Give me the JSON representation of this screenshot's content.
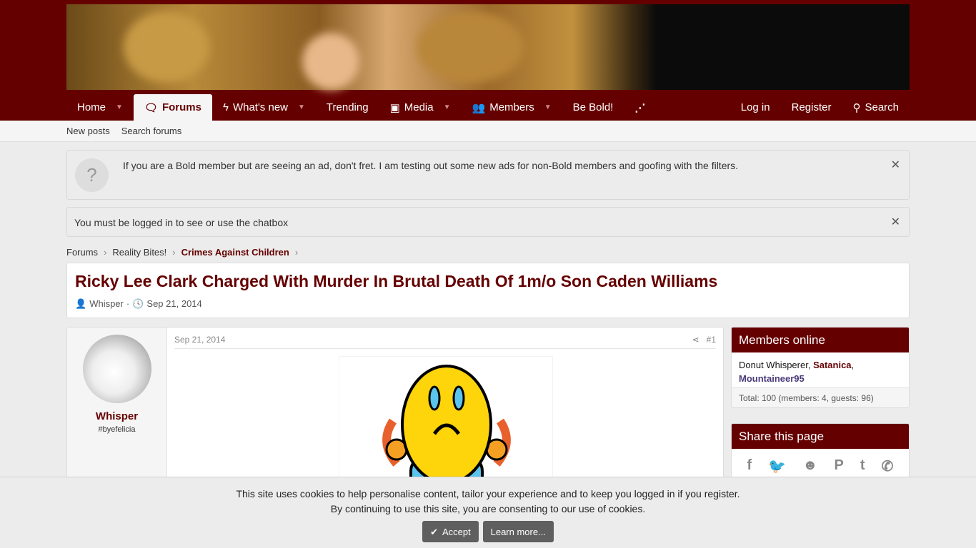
{
  "nav": {
    "items": [
      {
        "label": "Home",
        "caret": true
      },
      {
        "label": "Forums",
        "icon": "comments-icon",
        "selected": true
      },
      {
        "label": "What's new",
        "icon": "bolt-icon",
        "caret": true
      },
      {
        "label": "Trending"
      },
      {
        "label": "Media",
        "icon": "image-icon",
        "caret": true
      },
      {
        "label": "Members",
        "icon": "users-icon",
        "caret": true
      },
      {
        "label": "Be Bold!"
      }
    ],
    "rss": "rss-icon",
    "login": "Log in",
    "register": "Register",
    "search": "Search"
  },
  "subnav": [
    "New posts",
    "Search forums"
  ],
  "notices": {
    "bold": "If you are a Bold member but are seeing an ad, don't fret. I am testing out some new ads for non-Bold members and goofing with the filters.",
    "chat": "You must be logged in to see or use the chatbox",
    "help_glyph": "?",
    "close_glyph": "✕"
  },
  "breadcrumb": [
    "Forums",
    "Reality Bites!",
    "Crimes Against Children"
  ],
  "thread": {
    "title": "Ricky Lee Clark Charged With Murder In Brutal Death Of 1m/o Son Caden Williams",
    "author": "Whisper",
    "date": "Sep 21, 2014"
  },
  "post": {
    "username": "Whisper",
    "user_title": "#byefelicia",
    "date": "Sep 21, 2014",
    "number": "#1"
  },
  "members_online": {
    "title": "Members online",
    "members": [
      {
        "name": "Donut Whisperer",
        "color": "#141414"
      },
      {
        "name": "Satanica",
        "color": "#650000"
      },
      {
        "name": "Mountaineer95",
        "color": "#4a3a7a"
      }
    ],
    "total": "Total: 100 (members: 4, guests: 96)"
  },
  "share": {
    "title": "Share this page",
    "icons": [
      "facebook-icon",
      "twitter-icon",
      "reddit-icon",
      "pinterest-icon",
      "tumblr-icon",
      "whatsapp-icon"
    ],
    "glyphs": [
      "f",
      "🐦",
      "☻",
      "P",
      "t",
      "✆"
    ]
  },
  "cookie": {
    "line1": "This site uses cookies to help personalise content, tailor your experience and to keep you logged in if you register.",
    "line2": "By continuing to use this site, you are consenting to our use of cookies.",
    "accept": "Accept",
    "learn": "Learn more..."
  },
  "colors": {
    "brand": "#650000"
  }
}
